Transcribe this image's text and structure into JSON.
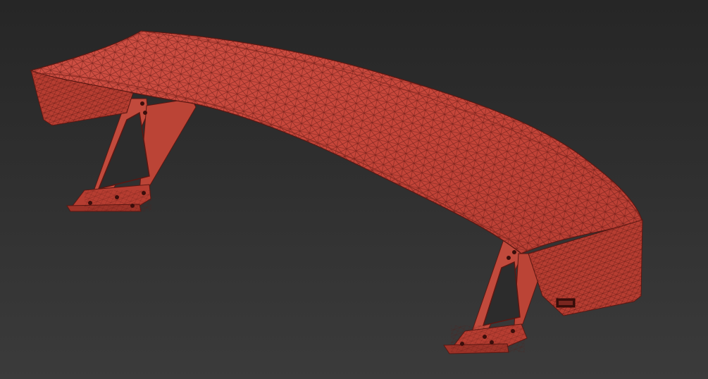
{
  "viewport": {
    "background_top": "#262626",
    "background_bottom": "#3b3b3b"
  },
  "model": {
    "display_mode": "wireframe-on-shaded",
    "fill_color": "#c6463a",
    "edge_color": "#5a1712",
    "endplate_color": "#b63d31",
    "strut_color": "#c14a3c",
    "bolt_color": "#3a0e0b"
  },
  "icons": {
    "viewcube": "viewcube-corner-icon"
  }
}
